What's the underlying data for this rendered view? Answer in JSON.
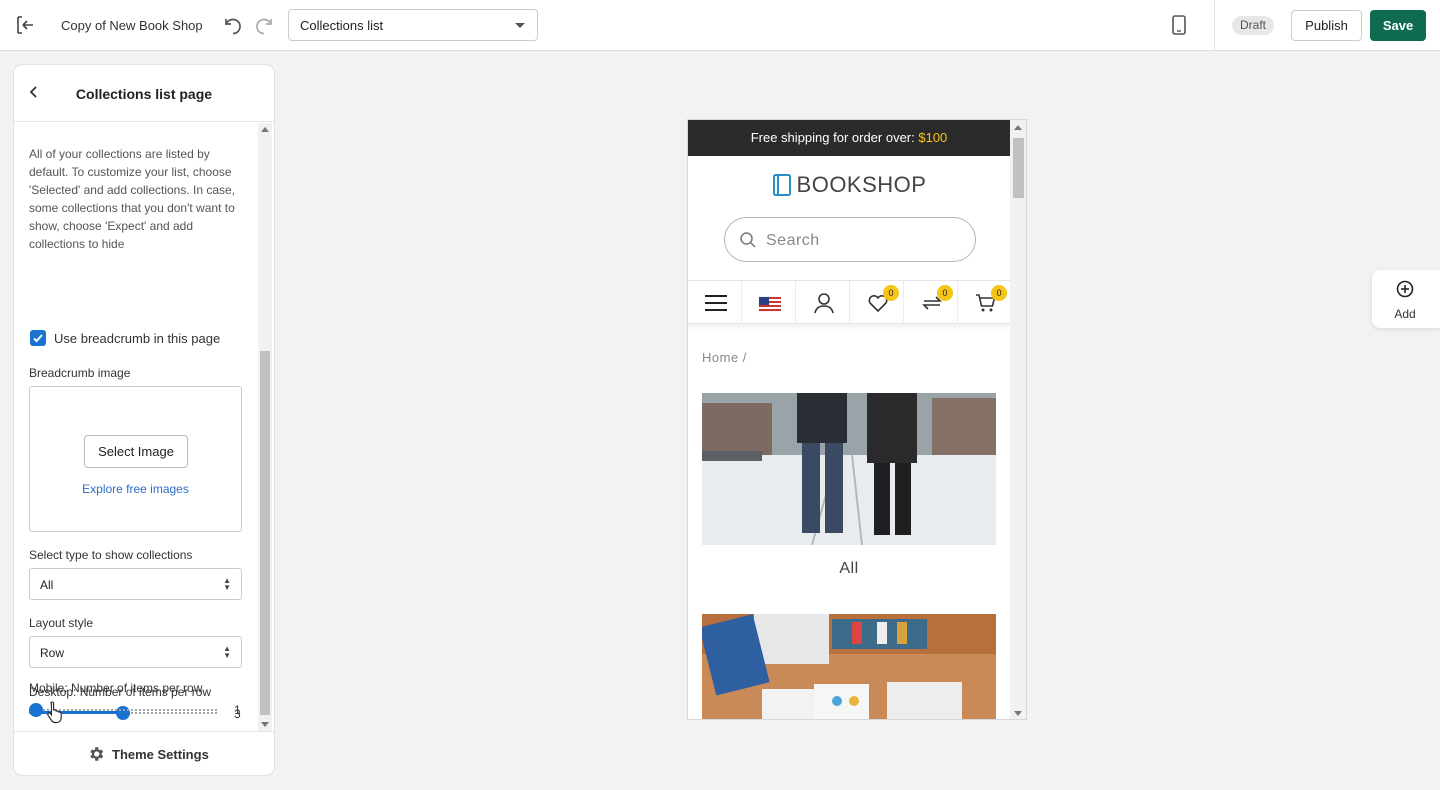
{
  "topbar": {
    "shop_name": "Copy of New Book Shop",
    "page_select": "Collections list",
    "draft_badge": "Draft",
    "publish_label": "Publish",
    "save_label": "Save"
  },
  "panel": {
    "title": "Collections list page",
    "description": "All of your collections are listed by default. To customize your list, choose 'Selected' and add collections. In case, some collections that you don't want to show, choose 'Expect' and add collections to hide",
    "breadcrumb_checkbox": {
      "label": "Use breadcrumb in this page",
      "checked": true
    },
    "breadcrumb_image": {
      "label": "Breadcrumb image",
      "select_button": "Select Image",
      "explore_link": "Explore free images"
    },
    "type_select": {
      "label": "Select type to show collections",
      "value": "All"
    },
    "layout_select": {
      "label": "Layout style",
      "value": "Row"
    },
    "desktop_slider": {
      "label": "Desktop: Number of items per row",
      "value": "3",
      "fraction": 0.5
    },
    "mobile_slider": {
      "label": "Mobile: Number of items per row",
      "value": "1",
      "fraction": 0
    },
    "footer_label": "Theme Settings"
  },
  "preview": {
    "announcement_text": "Free shipping for order over: ",
    "announcement_price": "$100",
    "logo_text": "BOOKSHOP",
    "search_placeholder": "Search",
    "wishlist_count": "0",
    "compare_count": "0",
    "cart_count": "0",
    "breadcrumb": "Home /",
    "collections": [
      {
        "label": "All"
      }
    ]
  },
  "add_button": {
    "label": "Add"
  },
  "colors": {
    "accent": "#1a73d1",
    "save": "#0e6b52",
    "badge": "#f5c518",
    "announce_bg": "#2b2b2b"
  }
}
